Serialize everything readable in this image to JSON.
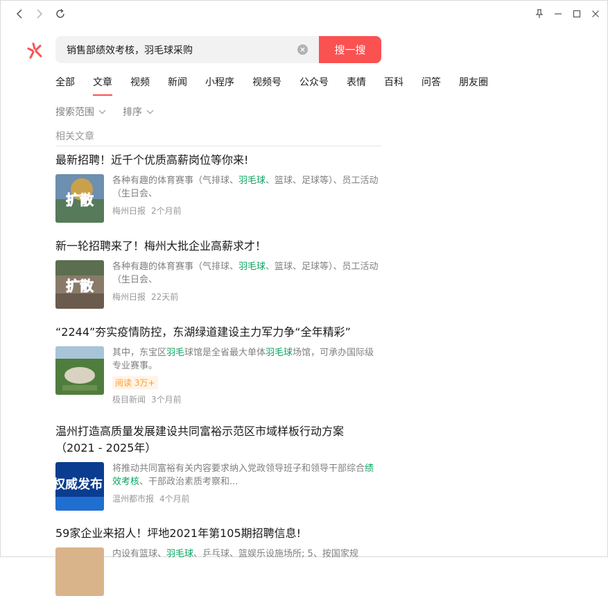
{
  "search": {
    "query": "销售部绩效考核，羽毛球采购",
    "button_label": "搜一搜"
  },
  "tabs": [
    "全部",
    "文章",
    "视频",
    "新闻",
    "小程序",
    "视频号",
    "公众号",
    "表情",
    "百科",
    "问答",
    "朋友圈"
  ],
  "active_tab": "文章",
  "filters": {
    "range": "搜索范围",
    "sort": "排序"
  },
  "section_title": "相关文章",
  "results": [
    {
      "title": "最新招聘！近千个优质高薪岗位等你来!",
      "snippet_parts": [
        "各种有趣的体育赛事（气排球、",
        "羽毛球",
        "、篮球、足球等）、员工活动（生日会、"
      ],
      "thumb_text": "扩散",
      "source": "梅州日报",
      "time": "2个月前"
    },
    {
      "title": "新一轮招聘来了！梅州大批企业高薪求才！",
      "snippet_parts": [
        "各种有趣的体育赛事（气排球、",
        "羽毛球",
        "、篮球、足球等）、员工活动（生日会、"
      ],
      "thumb_text": "扩散",
      "source": "梅州日报",
      "time": "22天前"
    },
    {
      "title": "“2244”夯实疫情防控，东湖绿道建设主力军力争“全年精彩”",
      "snippet_parts": [
        "其中，东宝区",
        "羽毛",
        "球馆是全省最大单体",
        "羽毛球",
        "场馆，可承办国际级专业赛事。"
      ],
      "badge": "阅读 3万+",
      "source": "极目新闻",
      "time": "3个月前"
    },
    {
      "title": "温州打造高质量发展建设共同富裕示范区市域样板行动方案（2021 - 2025年）",
      "snippet_parts": [
        "将推动共同富裕有关内容要求纳入党政领导班子和领导干部综合",
        "绩效考核",
        "、干部政治素质考察和..."
      ],
      "thumb_text": "权威发布",
      "source": "温州都市报",
      "time": "4个月前"
    },
    {
      "title": "59家企业来招人！坪地2021年第105期招聘信息!",
      "snippet_parts": [
        "内设有篮球、",
        "羽毛球",
        "、乒乓球、篮娱乐设施场所; 5、按国家规"
      ]
    }
  ],
  "colors": {
    "accent": "#fa5151",
    "highlight": "#07a45e",
    "badge": "#fa9d3b"
  },
  "icons": [
    "back-icon",
    "forward-icon",
    "refresh-icon",
    "pin-icon",
    "minimize-icon",
    "maximize-icon",
    "close-icon",
    "search-logo-icon",
    "clear-icon",
    "chevron-down-icon"
  ]
}
